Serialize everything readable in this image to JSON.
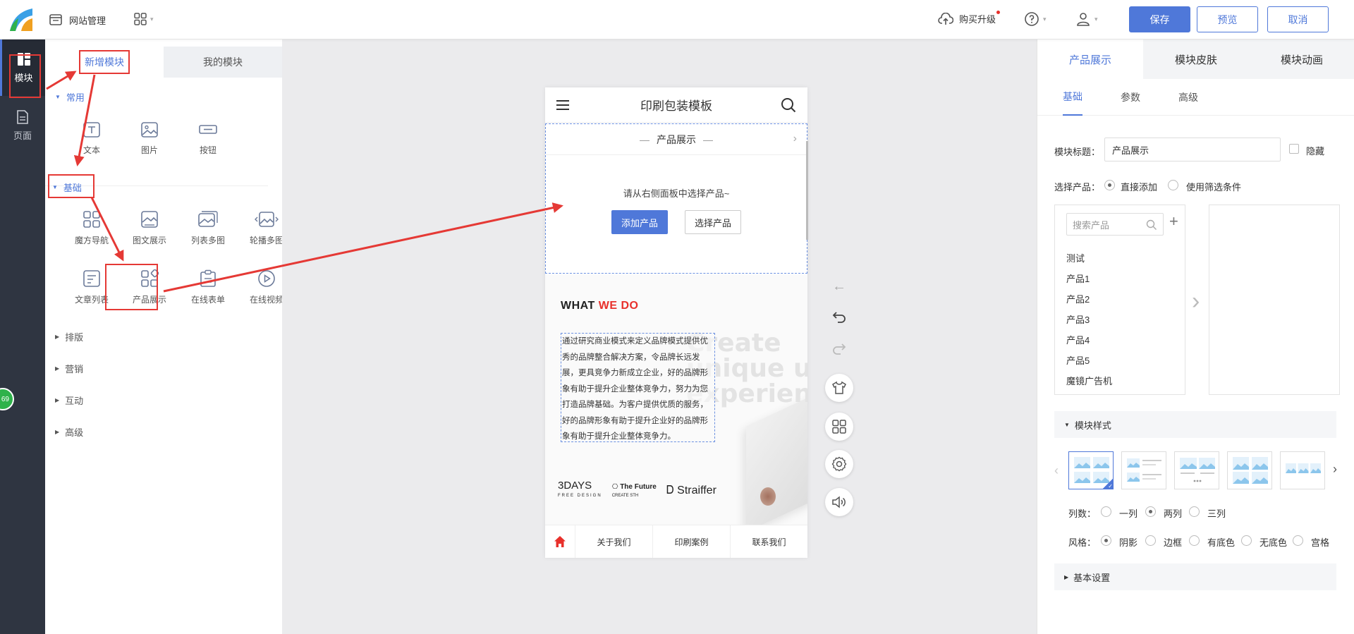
{
  "topbar": {
    "site_manage": "网站管理",
    "buy_upgrade": "购买升级",
    "save": "保存",
    "preview": "预览",
    "cancel": "取消"
  },
  "rail": {
    "module": "模块",
    "page": "页面",
    "badge": "69"
  },
  "panel": {
    "tab_new": "新增模块",
    "tab_mine": "我的模块",
    "sections": {
      "common": "常用",
      "basic": "基础",
      "layout": "排版",
      "marketing": "营销",
      "interaction": "互动",
      "advanced": "高级"
    },
    "common_mods": [
      "文本",
      "图片",
      "按钮"
    ],
    "basic_mods": [
      "魔方导航",
      "图文展示",
      "列表多图",
      "轮播多图",
      "文章列表",
      "产品展示",
      "在线表单",
      "在线视频"
    ]
  },
  "phone": {
    "title": "印刷包装模板",
    "prod_title": "产品展示",
    "prod_tip": "请从右侧面板中选择产品~",
    "add_btn": "添加产品",
    "choose_btn": "选择产品",
    "what_a": "WHAT ",
    "what_b": "WE DO",
    "bg_text": "Create\nunique user\nexperience",
    "body_text": "通过研究商业模式来定义品牌模式提供优秀的品牌整合解决方案，令品牌长远发展，更具竞争力新成立企业，好的品牌形象有助于提升企业整体竞争力，努力为您打造品牌基础。为客户提供优质的服务，好的品牌形象有助于提升企业好的品牌形象有助于提升企业整体竞争力。",
    "brand1": "3DAYS",
    "brand1_sub": "FREE DESIGN",
    "brand2": "The Future",
    "brand2_sub": "CREATE STH",
    "brand3": "Straiffer",
    "nav": [
      "关于我们",
      "印刷案例",
      "联系我们"
    ]
  },
  "rpanel": {
    "tabs": [
      "产品展示",
      "模块皮肤",
      "模块动画"
    ],
    "subtabs": [
      "基础",
      "参数",
      "高级"
    ],
    "title_label": "模块标题：",
    "title_value": "产品展示",
    "hide_label": "隐藏",
    "select_label": "选择产品：",
    "opt_direct": "直接添加",
    "opt_filter": "使用筛选条件",
    "search_placeholder": "搜索产品",
    "products": [
      "测试",
      "产品1",
      "产品2",
      "产品3",
      "产品4",
      "产品5",
      "魔镜广告机"
    ],
    "style_head": "模块样式",
    "cols_label": "列数：",
    "cols": [
      "一列",
      "两列",
      "三列"
    ],
    "style_label": "风格：",
    "styles": [
      "阴影",
      "边框",
      "有底色",
      "无底色",
      "宫格"
    ],
    "base_head": "基本设置"
  },
  "colors": {
    "accent": "#4f78d9",
    "rail": "#2f3541",
    "highlight": "#e53935"
  }
}
